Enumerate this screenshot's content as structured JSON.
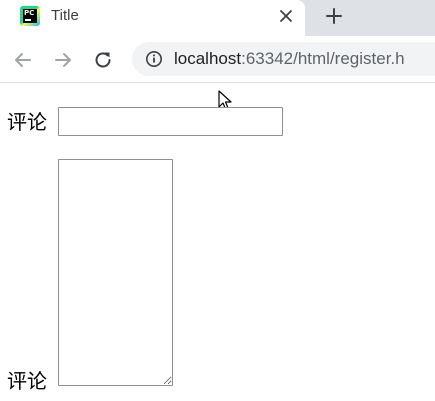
{
  "browser": {
    "tab": {
      "title": "Title",
      "favicon": "pycharm-icon",
      "close_icon": "close-icon"
    },
    "new_tab_icon": "plus-icon",
    "toolbar": {
      "back_icon": "arrow-left-icon",
      "forward_icon": "arrow-right-icon",
      "reload_icon": "reload-icon",
      "site_info_icon": "info-icon"
    },
    "address": {
      "host": "localhost",
      "rest": ":63342/html/register.h"
    }
  },
  "form": {
    "comment_label": "评论",
    "comment_value": "",
    "textarea_label": "评论",
    "textarea_value": ""
  },
  "colors": {
    "tabstrip_bg": "#dee1e6",
    "omnibox_bg": "#f1f3f4",
    "input_border": "#8f8f8f",
    "url_host": "#202124",
    "url_path": "#5f6368"
  }
}
